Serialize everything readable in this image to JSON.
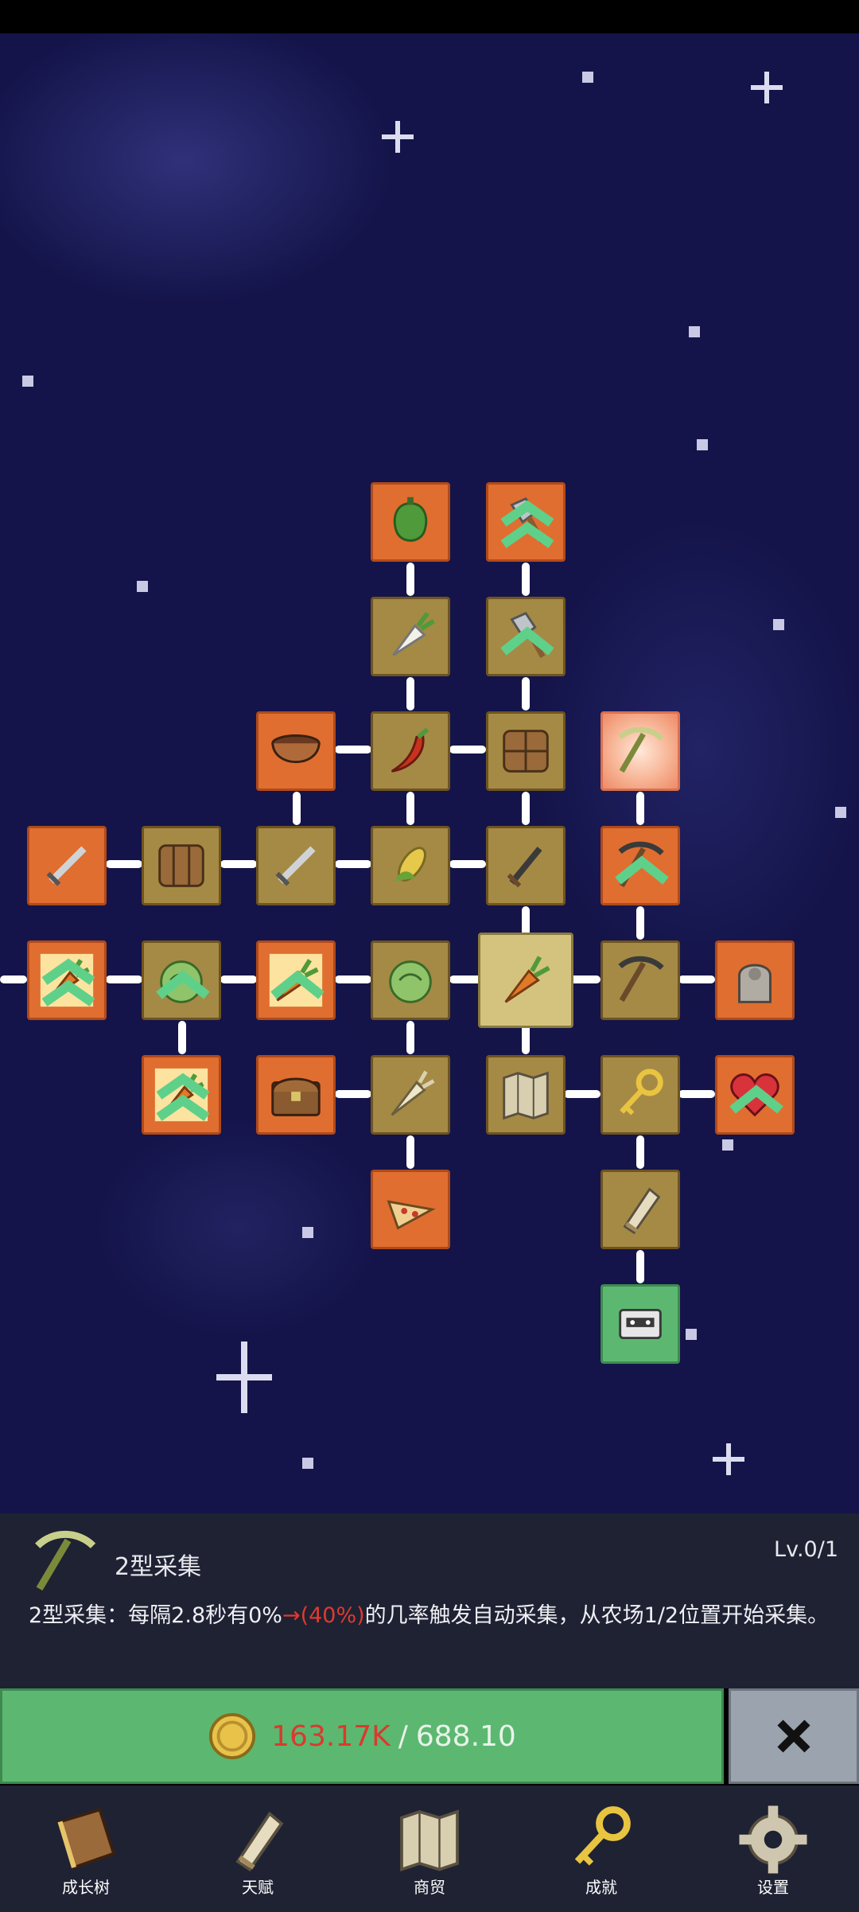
{
  "panel": {
    "title": "2型采集",
    "level": "Lv.0/1",
    "desc_before": "2型采集：每隔2.8秒有0%",
    "desc_change": "→(40%)",
    "desc_after": "的几率触发自动采集，从农场1/2位置开始采集。"
  },
  "cost": {
    "have": "163.17K",
    "separator": "/",
    "need": "688.10"
  },
  "nav": {
    "tree": "成长树",
    "talent": "天赋",
    "trade": "商贸",
    "achievement": "成就",
    "settings": "设置"
  },
  "colors": {
    "orange": "#e06e30",
    "olive": "#a58a45",
    "green": "#5cb870",
    "red": "#e03a2e"
  }
}
